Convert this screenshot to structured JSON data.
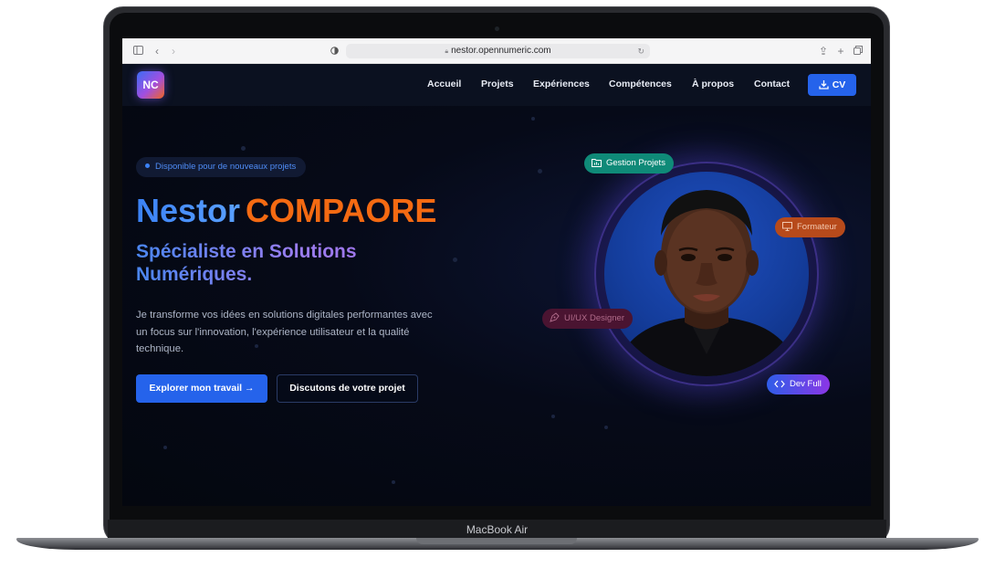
{
  "device": {
    "label": "MacBook Air"
  },
  "browser": {
    "url": "nestor.opennumeric.com"
  },
  "site": {
    "logo": "NC",
    "nav": {
      "items": [
        "Accueil",
        "Projets",
        "Expériences",
        "Compétences",
        "À propos",
        "Contact"
      ],
      "cv_label": "CV"
    },
    "hero": {
      "availability": "Disponible pour de nouveaux projets",
      "first_name": "Nestor",
      "last_name": "COMPAORE",
      "subtitle_line1": "Spécialiste en Solutions",
      "subtitle_line2": "Numériques.",
      "description": "Je transforme vos idées en solutions digitales performantes avec un focus sur l'innovation, l'expérience utilisateur et la qualité technique.",
      "primary_button": "Explorer mon travail →",
      "secondary_button": "Discutons de votre projet"
    },
    "badges": {
      "gestion": "Gestion Projets",
      "formateur": "Formateur",
      "uiux": "UI/UX Designer",
      "dev": "Dev Full"
    }
  },
  "colors": {
    "accent_blue": "#2563eb",
    "accent_orange": "#f46a12",
    "background": "#050914"
  }
}
